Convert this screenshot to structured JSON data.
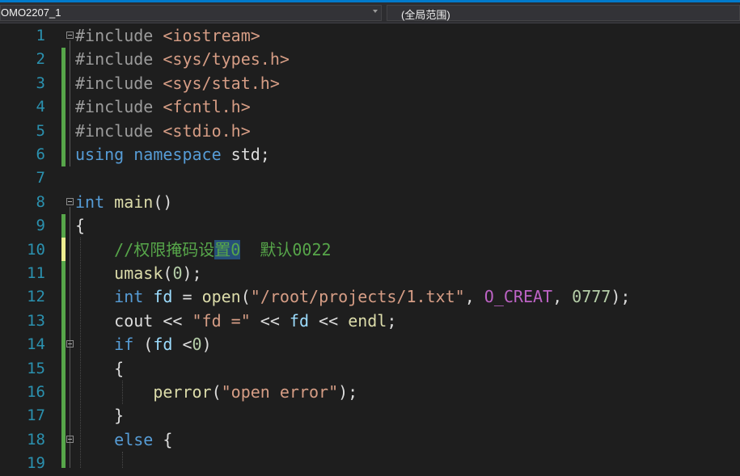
{
  "navbar": {
    "project_label": "OMO2207_1",
    "scope_label": "(全局范围)"
  },
  "lines": [
    {
      "num": "1",
      "tokens": [
        {
          "t": "#include ",
          "c": "pp"
        },
        {
          "t": "<iostream>",
          "c": "inc"
        }
      ]
    },
    {
      "num": "2",
      "tokens": [
        {
          "t": "#include ",
          "c": "pp"
        },
        {
          "t": "<sys/types.h>",
          "c": "inc"
        }
      ]
    },
    {
      "num": "3",
      "tokens": [
        {
          "t": "#include ",
          "c": "pp"
        },
        {
          "t": "<sys/stat.h>",
          "c": "inc"
        }
      ]
    },
    {
      "num": "4",
      "tokens": [
        {
          "t": "#include ",
          "c": "pp"
        },
        {
          "t": "<fcntl.h>",
          "c": "inc"
        }
      ]
    },
    {
      "num": "5",
      "tokens": [
        {
          "t": "#include ",
          "c": "pp"
        },
        {
          "t": "<stdio.h>",
          "c": "inc"
        }
      ]
    },
    {
      "num": "6",
      "tokens": [
        {
          "t": "using ",
          "c": "kw"
        },
        {
          "t": "namespace ",
          "c": "kw"
        },
        {
          "t": "std;",
          "c": "pl"
        }
      ]
    },
    {
      "num": "7",
      "tokens": []
    },
    {
      "num": "8",
      "tokens": [
        {
          "t": "int ",
          "c": "kw"
        },
        {
          "t": "main",
          "c": "fn"
        },
        {
          "t": "()",
          "c": "pl"
        }
      ]
    },
    {
      "num": "9",
      "tokens": [
        {
          "t": "{",
          "c": "pl"
        }
      ]
    },
    {
      "num": "10",
      "tokens": [
        {
          "t": "    ",
          "c": "pl"
        },
        {
          "t": "//权限掩码设",
          "c": "cm"
        },
        {
          "t": "置0",
          "c": "cm hl"
        },
        {
          "t": "  默认0022",
          "c": "cm"
        }
      ]
    },
    {
      "num": "11",
      "tokens": [
        {
          "t": "    ",
          "c": "pl"
        },
        {
          "t": "umask",
          "c": "fn"
        },
        {
          "t": "(",
          "c": "pl"
        },
        {
          "t": "0",
          "c": "num"
        },
        {
          "t": ");",
          "c": "pl"
        }
      ]
    },
    {
      "num": "12",
      "tokens": [
        {
          "t": "    ",
          "c": "pl"
        },
        {
          "t": "int ",
          "c": "kw"
        },
        {
          "t": "fd",
          "c": "var"
        },
        {
          "t": " = ",
          "c": "pl"
        },
        {
          "t": "open",
          "c": "fn"
        },
        {
          "t": "(",
          "c": "pl"
        },
        {
          "t": "\"/root/projects/1.txt\"",
          "c": "str"
        },
        {
          "t": ", ",
          "c": "pl"
        },
        {
          "t": "O_CREAT",
          "c": "mac"
        },
        {
          "t": ", ",
          "c": "pl"
        },
        {
          "t": "0777",
          "c": "num"
        },
        {
          "t": ");",
          "c": "pl"
        }
      ]
    },
    {
      "num": "13",
      "tokens": [
        {
          "t": "    cout << ",
          "c": "pl"
        },
        {
          "t": "\"fd =\"",
          "c": "str"
        },
        {
          "t": " << ",
          "c": "pl"
        },
        {
          "t": "fd",
          "c": "var"
        },
        {
          "t": " << ",
          "c": "pl"
        },
        {
          "t": "endl",
          "c": "fn"
        },
        {
          "t": ";",
          "c": "pl"
        }
      ]
    },
    {
      "num": "14",
      "tokens": [
        {
          "t": "    ",
          "c": "pl"
        },
        {
          "t": "if ",
          "c": "kw"
        },
        {
          "t": "(",
          "c": "pl"
        },
        {
          "t": "fd",
          "c": "var"
        },
        {
          "t": " <",
          "c": "pl"
        },
        {
          "t": "0",
          "c": "num"
        },
        {
          "t": ")",
          "c": "pl"
        }
      ]
    },
    {
      "num": "15",
      "tokens": [
        {
          "t": "    {",
          "c": "pl"
        }
      ]
    },
    {
      "num": "16",
      "tokens": [
        {
          "t": "        ",
          "c": "pl"
        },
        {
          "t": "perror",
          "c": "fn"
        },
        {
          "t": "(",
          "c": "pl"
        },
        {
          "t": "\"open error\"",
          "c": "str"
        },
        {
          "t": ");",
          "c": "pl"
        }
      ]
    },
    {
      "num": "17",
      "tokens": [
        {
          "t": "    }",
          "c": "pl"
        }
      ]
    },
    {
      "num": "18",
      "tokens": [
        {
          "t": "    ",
          "c": "pl"
        },
        {
          "t": "else ",
          "c": "kw"
        },
        {
          "t": "{",
          "c": "pl"
        }
      ]
    },
    {
      "num": "19",
      "tokens": []
    }
  ]
}
